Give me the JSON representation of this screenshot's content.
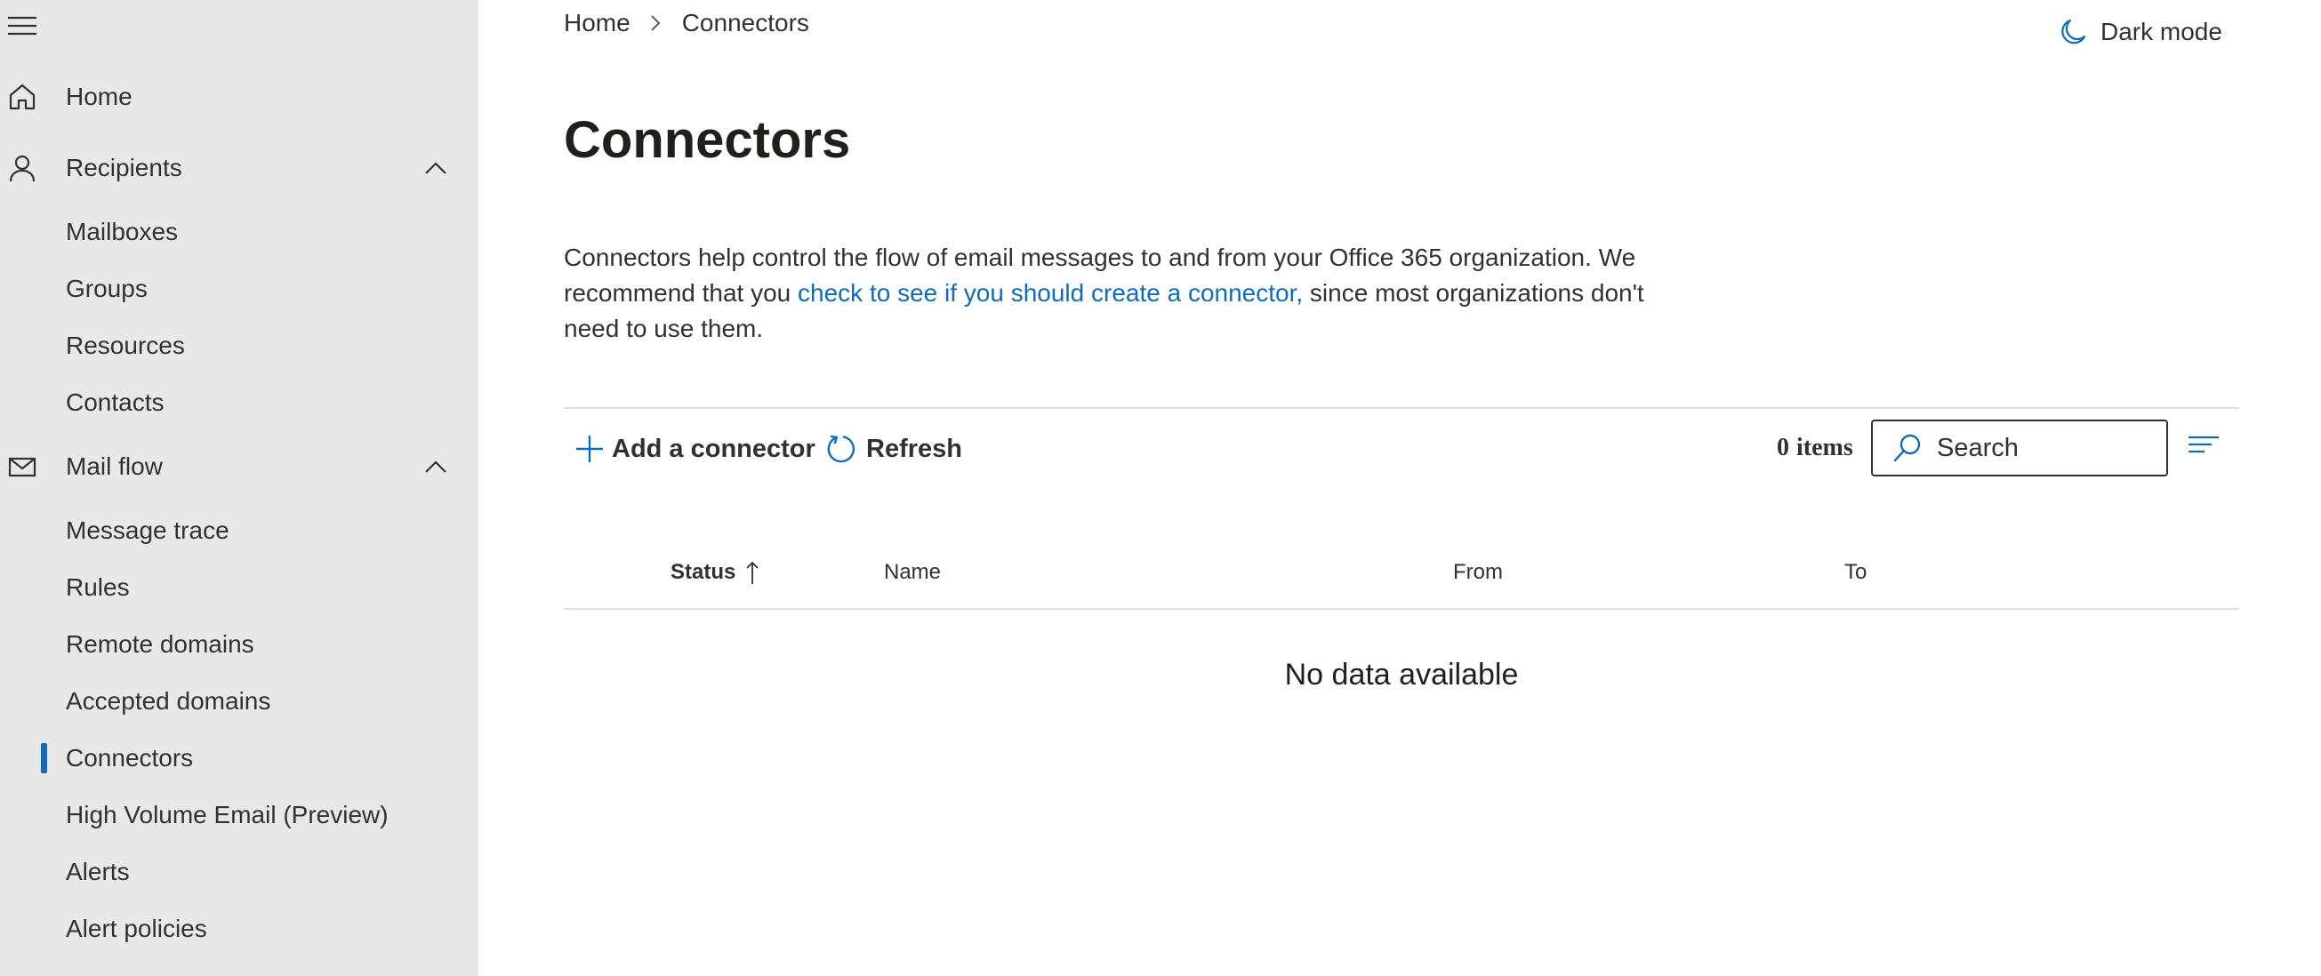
{
  "breadcrumb": {
    "home": "Home",
    "current": "Connectors"
  },
  "header": {
    "dark_mode_label": "Dark mode"
  },
  "sidebar": {
    "home": "Home",
    "recipients": {
      "label": "Recipients",
      "items": [
        "Mailboxes",
        "Groups",
        "Resources",
        "Contacts"
      ]
    },
    "mail_flow": {
      "label": "Mail flow",
      "items": [
        "Message trace",
        "Rules",
        "Remote domains",
        "Accepted domains",
        "Connectors",
        "High Volume Email (Preview)",
        "Alerts",
        "Alert policies"
      ],
      "active": "Connectors"
    }
  },
  "page": {
    "title": "Connectors",
    "description": {
      "before": "Connectors help control the flow of email messages to and from your Office 365 organization. We recommend that you ",
      "link": "check to see if you should create a connector,",
      "after": " since most organizations don't need to use them."
    }
  },
  "toolbar": {
    "add_label": "Add a connector",
    "refresh_label": "Refresh",
    "count": "0",
    "count_suffix": "items",
    "search_placeholder": "Search"
  },
  "table": {
    "columns": [
      "Status",
      "Name",
      "From",
      "To"
    ],
    "sorted_column": "Status",
    "sort_direction": "ascending",
    "empty_message": "No data available"
  },
  "icons": {
    "menu": "hamburger-icon",
    "home": "home-icon",
    "recipients": "person-icon",
    "mail_flow": "mail-icon",
    "chevron": "chevron-up-icon",
    "breadcrumb_sep": "chevron-right-icon",
    "dark_mode": "moon-icon",
    "add": "plus-icon",
    "refresh": "refresh-icon",
    "search": "search-icon",
    "filter": "filter-lines-icon",
    "sort": "arrow-up-icon"
  },
  "colors": {
    "accent": "#0f6cbd",
    "sidebar_bg": "#e8e8e8",
    "text": "#323130"
  }
}
